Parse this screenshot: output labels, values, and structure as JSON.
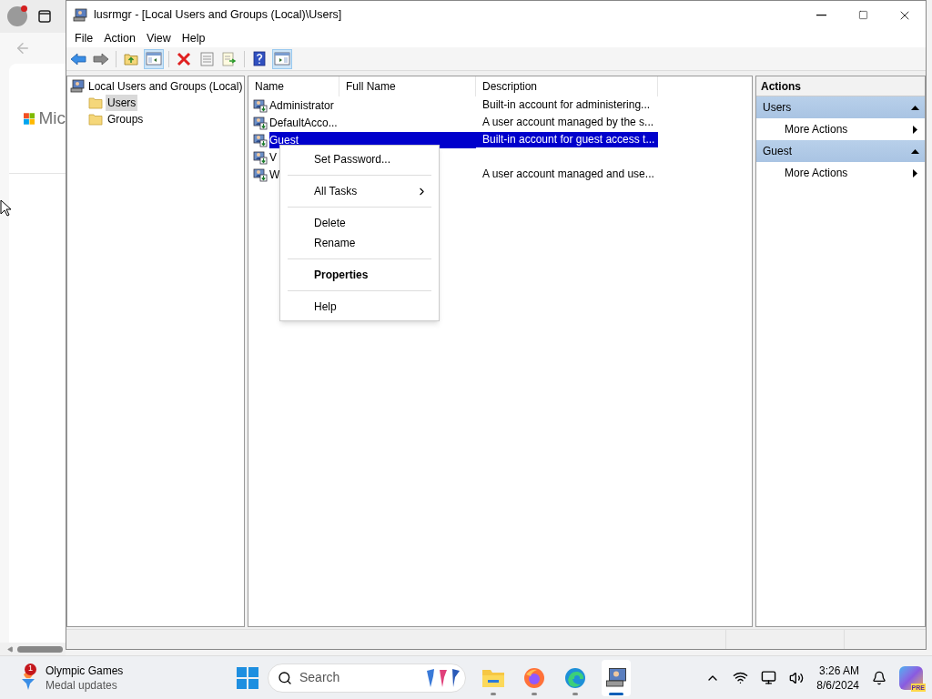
{
  "browser": {
    "logo_text": "Mic"
  },
  "window": {
    "title": "lusrmgr - [Local Users and Groups (Local)\\Users]"
  },
  "menu": [
    "File",
    "Action",
    "View",
    "Help"
  ],
  "toolbar": [
    {
      "kind": "back",
      "selected": false
    },
    {
      "kind": "forward",
      "selected": false
    },
    {
      "kind": "separator"
    },
    {
      "kind": "up",
      "selected": false
    },
    {
      "kind": "tree",
      "selected": true
    },
    {
      "kind": "separator"
    },
    {
      "kind": "delete",
      "selected": false
    },
    {
      "kind": "properties",
      "selected": false
    },
    {
      "kind": "export",
      "selected": false
    },
    {
      "kind": "separator"
    },
    {
      "kind": "help",
      "selected": false
    },
    {
      "kind": "pane",
      "selected": true
    }
  ],
  "tree": {
    "label": "Local Users and Groups (Local)",
    "children": [
      {
        "label": "Users",
        "selected": true
      },
      {
        "label": "Groups",
        "selected": false
      }
    ]
  },
  "list": {
    "columns": [
      "Name",
      "Full Name",
      "Description"
    ],
    "rows": [
      {
        "name": "Administrator",
        "description": "Built-in account for administering...",
        "selected": false
      },
      {
        "name": "DefaultAcco...",
        "description": "A user account managed by the s...",
        "selected": false
      },
      {
        "name": "Guest",
        "description": "Built-in account for guest access t...",
        "selected": true
      },
      {
        "name": "V",
        "selected": false
      },
      {
        "name": "W",
        "description": "A user account managed and use...",
        "selected": false
      }
    ]
  },
  "context_menu": [
    {
      "kind": "item",
      "label": "Set Password...",
      "default": false
    },
    {
      "kind": "separator"
    },
    {
      "kind": "submenu",
      "label": "All Tasks",
      "default": false
    },
    {
      "kind": "separator"
    },
    {
      "kind": "item",
      "label": "Delete",
      "default": false
    },
    {
      "kind": "item",
      "label": "Rename",
      "default": false
    },
    {
      "kind": "separator"
    },
    {
      "kind": "item",
      "label": "Properties",
      "default": true
    },
    {
      "kind": "separator"
    },
    {
      "kind": "item",
      "label": "Help",
      "default": false
    }
  ],
  "actions": {
    "title": "Actions",
    "sections": [
      {
        "title": "Users",
        "expanded": true,
        "items": [
          "More Actions"
        ]
      },
      {
        "title": "Guest",
        "expanded": true,
        "items": [
          "More Actions"
        ]
      }
    ]
  },
  "taskbar": {
    "widget": {
      "title": "Olympic Games",
      "subtitle": "Medal updates",
      "badge": "1"
    },
    "search": "Search",
    "apps": [
      {
        "kind": "explorer",
        "active": false
      },
      {
        "kind": "firefox",
        "active": false
      },
      {
        "kind": "edge",
        "active": false
      },
      {
        "kind": "lusrmgr",
        "active": true
      }
    ],
    "time": "3:26 AM",
    "date": "8/6/2024",
    "copilot_badge": "PRE"
  }
}
